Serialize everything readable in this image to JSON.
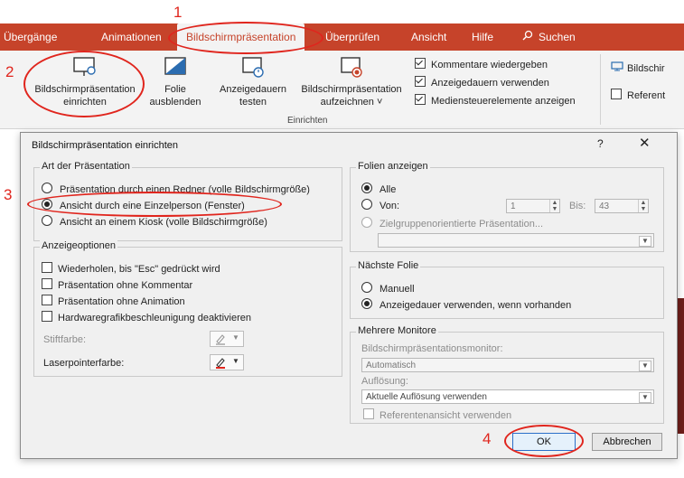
{
  "ribbon": {
    "tabs": [
      "Übergänge",
      "Animationen",
      "Bildschirmpräsentation",
      "Überprüfen",
      "Ansicht",
      "Hilfe"
    ],
    "search_label": "Suchen",
    "buttons": {
      "setup": [
        "Bildschirmpräsentation",
        "einrichten"
      ],
      "hide": [
        "Folie",
        "ausblenden"
      ],
      "rehearse": [
        "Anzeigedauern",
        "testen"
      ],
      "record": [
        "Bildschirmpräsentation",
        "aufzeichnen ˅"
      ]
    },
    "group_label": "Einrichten",
    "checks": [
      {
        "label": "Kommentare wiedergeben",
        "checked": true
      },
      {
        "label": "Anzeigedauern verwenden",
        "checked": true
      },
      {
        "label": "Mediensteuerelemente anzeigen",
        "checked": true
      }
    ],
    "monitor_label": "Bildschir",
    "presenter_label": "Referent"
  },
  "dialog": {
    "title": "Bildschirmpräsentation einrichten",
    "help": "?",
    "close": "✕",
    "type_group": {
      "legend": "Art der Präsentation",
      "options": [
        "Präsentation durch einen Redner (volle Bildschirmgröße)",
        "Ansicht durch eine Einzelperson (Fenster)",
        "Ansicht an einem Kiosk (volle Bildschirmgröße)"
      ],
      "selected": 1
    },
    "display_group": {
      "legend": "Anzeigeoptionen",
      "options": [
        "Wiederholen, bis \"Esc\" gedrückt wird",
        "Präsentation ohne Kommentar",
        "Präsentation ohne Animation",
        "Hardwaregrafikbeschleunigung deaktivieren"
      ],
      "pen_color_label": "Stiftfarbe:",
      "laser_color_label": "Laserpointerfarbe:",
      "laser_color": "#e0251d"
    },
    "slides_group": {
      "legend": "Folien anzeigen",
      "all_label": "Alle",
      "from_label": "Von:",
      "from_value": "1",
      "to_label": "Bis:",
      "to_value": "43",
      "custom_label": "Zielgruppenorientierte Präsentation..."
    },
    "advance_group": {
      "legend": "Nächste Folie",
      "manual_label": "Manuell",
      "timings_label": "Anzeigedauer verwenden, wenn vorhanden"
    },
    "monitors_group": {
      "legend": "Mehrere Monitore",
      "monitor_label": "Bildschirmpräsentationsmonitor:",
      "monitor_value": "Automatisch",
      "resolution_label": "Auflösung:",
      "resolution_value": "Aktuelle Auflösung verwenden",
      "presenter_view_label": "Referentenansicht verwenden"
    },
    "ok_label": "OK",
    "cancel_label": "Abbrechen"
  },
  "annotations": {
    "n1": "1",
    "n2": "2",
    "n3": "3",
    "n4": "4",
    "color": "#e0251d"
  }
}
